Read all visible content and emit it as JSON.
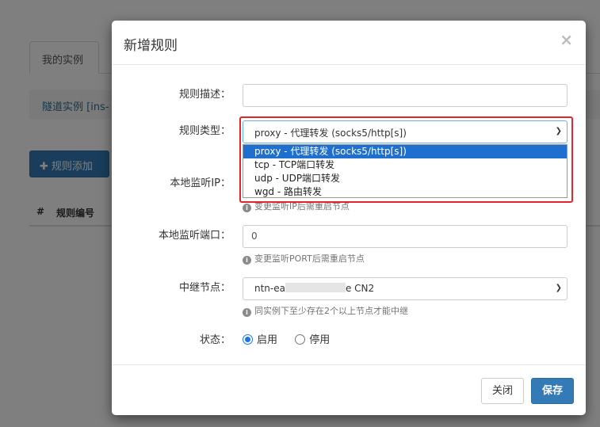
{
  "background": {
    "tab_label": "我的实例",
    "tunnel_text": "隧道实例 [ins-",
    "add_rule_label": "规则添加",
    "table_headers": [
      "#",
      "规则编号"
    ]
  },
  "modal": {
    "title": "新增规则",
    "close_glyph": "×",
    "fields": {
      "description": {
        "label": "规则描述：",
        "value": ""
      },
      "rule_type": {
        "label": "规则类型：",
        "selected": "proxy - 代理转发 (socks5/http[s])",
        "options": [
          "proxy - 代理转发 (socks5/http[s])",
          "tcp - TCP端口转发",
          "udp - UDP端口转发",
          "wgd - 路由转发"
        ]
      },
      "local_ip": {
        "label": "本地监听IP：",
        "help": "变更监听IP后需重启节点"
      },
      "local_port": {
        "label": "本地监听端口：",
        "value": "0",
        "help": "变更监听PORT后需重启节点"
      },
      "relay_node": {
        "label": "中继节点：",
        "value_prefix": "ntn-ea",
        "value_suffix": "e CN2",
        "help": "同实例下至少存在2个以上节点才能中继"
      },
      "status": {
        "label": "状态：",
        "options": [
          "启用",
          "停用"
        ],
        "selected": "启用"
      }
    },
    "footer": {
      "close_label": "关闭",
      "save_label": "保存"
    }
  },
  "colors": {
    "primary": "#337ab7",
    "highlight_border": "#e3242b",
    "selected_option": "#1e6fd0"
  }
}
